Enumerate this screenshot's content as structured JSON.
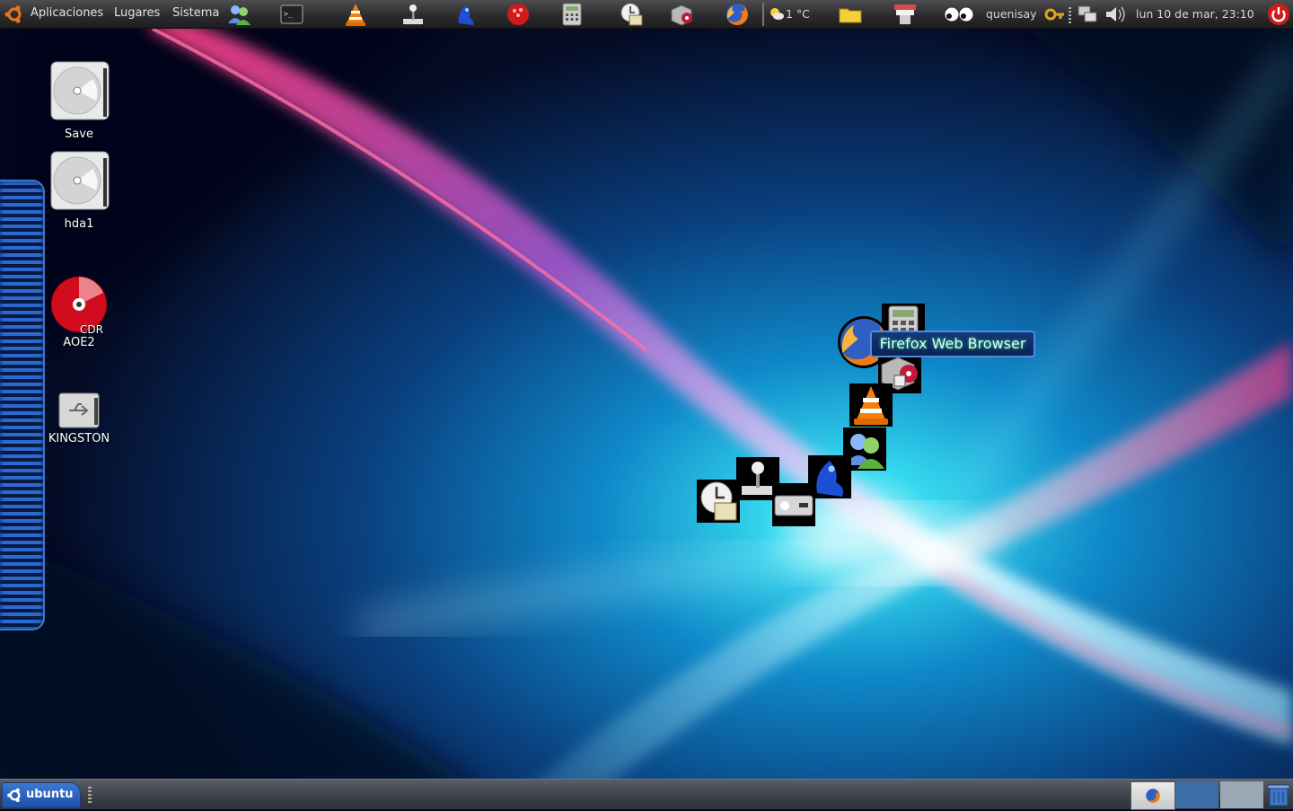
{
  "top_panel": {
    "menus": {
      "applications": "Aplicaciones",
      "places": "Lugares",
      "system": "Sistema"
    },
    "launchers": [
      "users-icon",
      "terminal-icon",
      "vlc-icon",
      "joystick-icon",
      "frog-icon",
      "red-ball-icon",
      "calculator-icon",
      "mail-clock-icon",
      "package-icon",
      "firefox-icon"
    ],
    "weather": "1 °C",
    "username": "quenisay",
    "clock": "lun 10 de mar, 23:10"
  },
  "desktop_icons": [
    {
      "label": "Save",
      "icon": "hard-drive-icon"
    },
    {
      "label": "hda1",
      "icon": "hard-drive-icon"
    },
    {
      "label": "AOE2",
      "icon": "cdr-disc-icon",
      "overlay": "CDR"
    },
    {
      "label": "KINGSTON",
      "icon": "usb-drive-icon"
    }
  ],
  "dock": {
    "tooltip": "Firefox Web Browser"
  },
  "bottom_panel": {
    "ubuntu_label": "ubuntu",
    "workspaces": 3,
    "active_workspace": 1
  },
  "colors": {
    "panel_dark": "#2c2c2e",
    "ubuntu_blue": "#2f63c0",
    "tooltip_border": "#4f8be0",
    "drawer_blue": "#2d6ad0"
  }
}
